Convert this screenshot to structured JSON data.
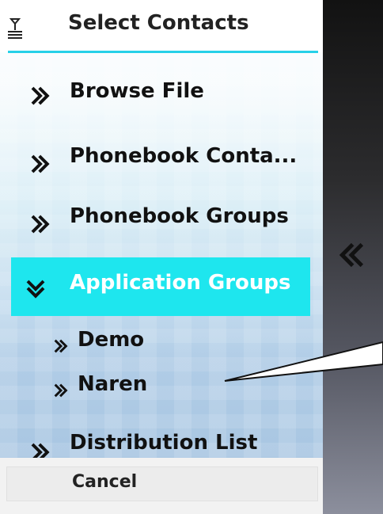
{
  "header": {
    "title": "Select Contacts",
    "icon": "signal-strength-icon"
  },
  "menu": [
    {
      "label": "Browse File",
      "level": 0,
      "expanded": false
    },
    {
      "label": "Phonebook Conta...",
      "level": 0,
      "expanded": false
    },
    {
      "label": "Phonebook Groups",
      "level": 0,
      "expanded": false
    },
    {
      "label": "Application Groups",
      "level": 0,
      "expanded": true,
      "selected": true
    },
    {
      "label": "Demo",
      "level": 1
    },
    {
      "label": "Naren",
      "level": 1
    },
    {
      "label": "Distribution List",
      "level": 0,
      "expanded": false
    }
  ],
  "footer": {
    "cancel_label": "Cancel"
  },
  "side": {
    "collapse_icon": "double-chevron-left-icon"
  },
  "colors": {
    "accent": "#1ee6ee",
    "header_line": "#27d0e8",
    "text": "#111111"
  }
}
